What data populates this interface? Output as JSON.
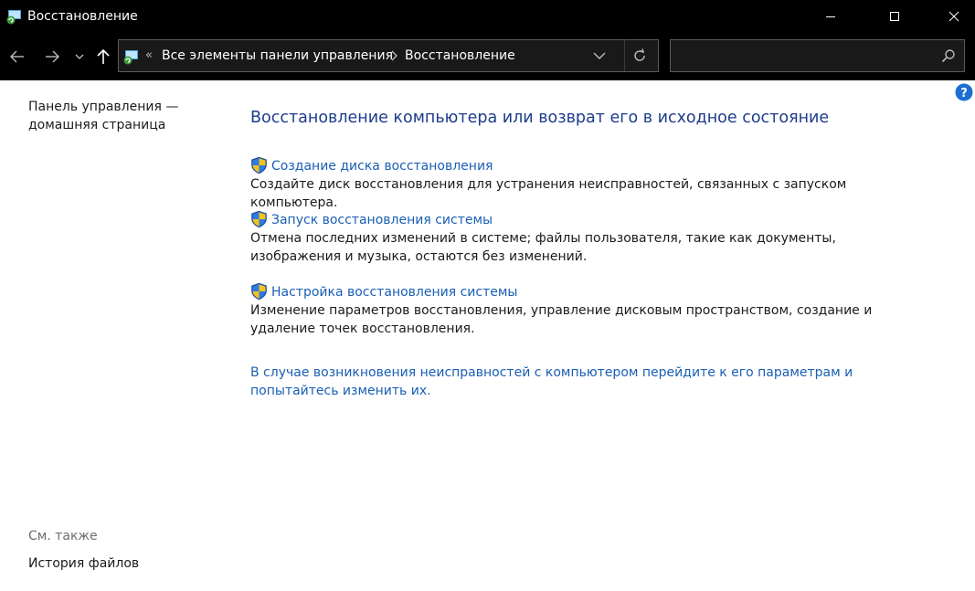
{
  "window": {
    "title": "Восстановление",
    "app_icon": "recovery-icon"
  },
  "nav": {
    "back_icon": "arrow-left-icon",
    "forward_icon": "arrow-right-icon",
    "recent_icon": "chevron-down-icon",
    "up_icon": "arrow-up-icon"
  },
  "address": {
    "overflow": "«",
    "crumbs": [
      "Все элементы панели управления",
      "Восстановление"
    ]
  },
  "search": {
    "placeholder": "",
    "value": ""
  },
  "left_pane": {
    "home_link": "Панель управления — домашняя страница",
    "see_also_label": "См. также",
    "see_also_items": [
      "История файлов"
    ]
  },
  "main": {
    "title": "Восстановление компьютера или возврат его в исходное состояние",
    "tasks": [
      {
        "link": "Создание диска восстановления",
        "description": "Создайте диск восстановления для устранения неисправностей, связанных с запуском компьютера."
      },
      {
        "link": "Запуск восстановления системы",
        "description": "Отмена последних изменений в системе; файлы пользователя, такие как документы, изображения и музыка, остаются без изменений."
      },
      {
        "link": "Настройка восстановления системы",
        "description": "Изменение параметров восстановления, управление дисковым пространством, создание и удаление точек восстановления."
      }
    ],
    "bottom_link": "В случае возникновения неисправностей с компьютером перейдите к его параметрам и попытайтесь изменить их."
  },
  "colors": {
    "title_blue": "#1e3c8c",
    "link_blue": "#1a5fb4",
    "chrome_black": "#000000"
  }
}
